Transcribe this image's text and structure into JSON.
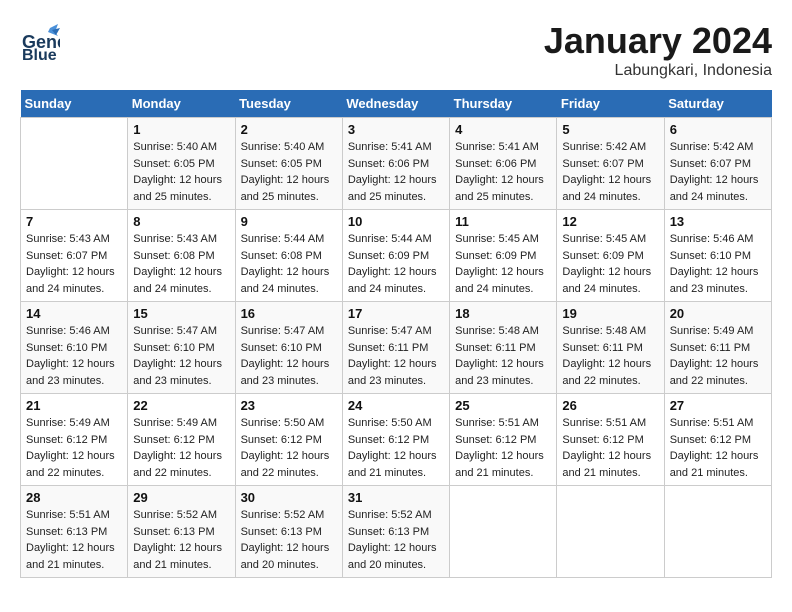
{
  "logo": {
    "line1": "General",
    "line2": "Blue"
  },
  "title": "January 2024",
  "location": "Labungkari, Indonesia",
  "days_header": [
    "Sunday",
    "Monday",
    "Tuesday",
    "Wednesday",
    "Thursday",
    "Friday",
    "Saturday"
  ],
  "weeks": [
    [
      {
        "day": "",
        "sunrise": "",
        "sunset": "",
        "daylight": ""
      },
      {
        "day": "1",
        "sunrise": "Sunrise: 5:40 AM",
        "sunset": "Sunset: 6:05 PM",
        "daylight": "Daylight: 12 hours and 25 minutes."
      },
      {
        "day": "2",
        "sunrise": "Sunrise: 5:40 AM",
        "sunset": "Sunset: 6:05 PM",
        "daylight": "Daylight: 12 hours and 25 minutes."
      },
      {
        "day": "3",
        "sunrise": "Sunrise: 5:41 AM",
        "sunset": "Sunset: 6:06 PM",
        "daylight": "Daylight: 12 hours and 25 minutes."
      },
      {
        "day": "4",
        "sunrise": "Sunrise: 5:41 AM",
        "sunset": "Sunset: 6:06 PM",
        "daylight": "Daylight: 12 hours and 25 minutes."
      },
      {
        "day": "5",
        "sunrise": "Sunrise: 5:42 AM",
        "sunset": "Sunset: 6:07 PM",
        "daylight": "Daylight: 12 hours and 24 minutes."
      },
      {
        "day": "6",
        "sunrise": "Sunrise: 5:42 AM",
        "sunset": "Sunset: 6:07 PM",
        "daylight": "Daylight: 12 hours and 24 minutes."
      }
    ],
    [
      {
        "day": "7",
        "sunrise": "Sunrise: 5:43 AM",
        "sunset": "Sunset: 6:07 PM",
        "daylight": "Daylight: 12 hours and 24 minutes."
      },
      {
        "day": "8",
        "sunrise": "Sunrise: 5:43 AM",
        "sunset": "Sunset: 6:08 PM",
        "daylight": "Daylight: 12 hours and 24 minutes."
      },
      {
        "day": "9",
        "sunrise": "Sunrise: 5:44 AM",
        "sunset": "Sunset: 6:08 PM",
        "daylight": "Daylight: 12 hours and 24 minutes."
      },
      {
        "day": "10",
        "sunrise": "Sunrise: 5:44 AM",
        "sunset": "Sunset: 6:09 PM",
        "daylight": "Daylight: 12 hours and 24 minutes."
      },
      {
        "day": "11",
        "sunrise": "Sunrise: 5:45 AM",
        "sunset": "Sunset: 6:09 PM",
        "daylight": "Daylight: 12 hours and 24 minutes."
      },
      {
        "day": "12",
        "sunrise": "Sunrise: 5:45 AM",
        "sunset": "Sunset: 6:09 PM",
        "daylight": "Daylight: 12 hours and 24 minutes."
      },
      {
        "day": "13",
        "sunrise": "Sunrise: 5:46 AM",
        "sunset": "Sunset: 6:10 PM",
        "daylight": "Daylight: 12 hours and 23 minutes."
      }
    ],
    [
      {
        "day": "14",
        "sunrise": "Sunrise: 5:46 AM",
        "sunset": "Sunset: 6:10 PM",
        "daylight": "Daylight: 12 hours and 23 minutes."
      },
      {
        "day": "15",
        "sunrise": "Sunrise: 5:47 AM",
        "sunset": "Sunset: 6:10 PM",
        "daylight": "Daylight: 12 hours and 23 minutes."
      },
      {
        "day": "16",
        "sunrise": "Sunrise: 5:47 AM",
        "sunset": "Sunset: 6:10 PM",
        "daylight": "Daylight: 12 hours and 23 minutes."
      },
      {
        "day": "17",
        "sunrise": "Sunrise: 5:47 AM",
        "sunset": "Sunset: 6:11 PM",
        "daylight": "Daylight: 12 hours and 23 minutes."
      },
      {
        "day": "18",
        "sunrise": "Sunrise: 5:48 AM",
        "sunset": "Sunset: 6:11 PM",
        "daylight": "Daylight: 12 hours and 23 minutes."
      },
      {
        "day": "19",
        "sunrise": "Sunrise: 5:48 AM",
        "sunset": "Sunset: 6:11 PM",
        "daylight": "Daylight: 12 hours and 22 minutes."
      },
      {
        "day": "20",
        "sunrise": "Sunrise: 5:49 AM",
        "sunset": "Sunset: 6:11 PM",
        "daylight": "Daylight: 12 hours and 22 minutes."
      }
    ],
    [
      {
        "day": "21",
        "sunrise": "Sunrise: 5:49 AM",
        "sunset": "Sunset: 6:12 PM",
        "daylight": "Daylight: 12 hours and 22 minutes."
      },
      {
        "day": "22",
        "sunrise": "Sunrise: 5:49 AM",
        "sunset": "Sunset: 6:12 PM",
        "daylight": "Daylight: 12 hours and 22 minutes."
      },
      {
        "day": "23",
        "sunrise": "Sunrise: 5:50 AM",
        "sunset": "Sunset: 6:12 PM",
        "daylight": "Daylight: 12 hours and 22 minutes."
      },
      {
        "day": "24",
        "sunrise": "Sunrise: 5:50 AM",
        "sunset": "Sunset: 6:12 PM",
        "daylight": "Daylight: 12 hours and 21 minutes."
      },
      {
        "day": "25",
        "sunrise": "Sunrise: 5:51 AM",
        "sunset": "Sunset: 6:12 PM",
        "daylight": "Daylight: 12 hours and 21 minutes."
      },
      {
        "day": "26",
        "sunrise": "Sunrise: 5:51 AM",
        "sunset": "Sunset: 6:12 PM",
        "daylight": "Daylight: 12 hours and 21 minutes."
      },
      {
        "day": "27",
        "sunrise": "Sunrise: 5:51 AM",
        "sunset": "Sunset: 6:12 PM",
        "daylight": "Daylight: 12 hours and 21 minutes."
      }
    ],
    [
      {
        "day": "28",
        "sunrise": "Sunrise: 5:51 AM",
        "sunset": "Sunset: 6:13 PM",
        "daylight": "Daylight: 12 hours and 21 minutes."
      },
      {
        "day": "29",
        "sunrise": "Sunrise: 5:52 AM",
        "sunset": "Sunset: 6:13 PM",
        "daylight": "Daylight: 12 hours and 21 minutes."
      },
      {
        "day": "30",
        "sunrise": "Sunrise: 5:52 AM",
        "sunset": "Sunset: 6:13 PM",
        "daylight": "Daylight: 12 hours and 20 minutes."
      },
      {
        "day": "31",
        "sunrise": "Sunrise: 5:52 AM",
        "sunset": "Sunset: 6:13 PM",
        "daylight": "Daylight: 12 hours and 20 minutes."
      },
      {
        "day": "",
        "sunrise": "",
        "sunset": "",
        "daylight": ""
      },
      {
        "day": "",
        "sunrise": "",
        "sunset": "",
        "daylight": ""
      },
      {
        "day": "",
        "sunrise": "",
        "sunset": "",
        "daylight": ""
      }
    ]
  ]
}
